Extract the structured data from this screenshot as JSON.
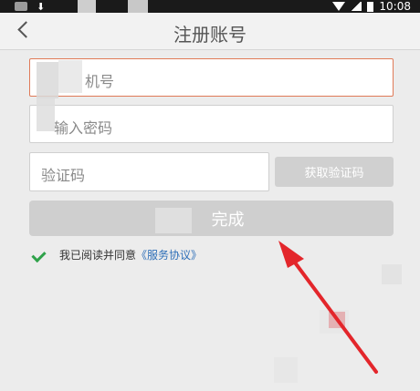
{
  "status_bar": {
    "time": "10:08"
  },
  "header": {
    "title": "注册账号"
  },
  "form": {
    "phone_placeholder": "机号",
    "password_placeholder": "输入密码",
    "code_placeholder": "验证码",
    "get_code_label": "获取验证码",
    "submit_label": "完成"
  },
  "agreement": {
    "text": "我已阅读并同意",
    "link": "《服务协议》",
    "checked": true
  },
  "colors": {
    "accent_border": "#e07a57",
    "link": "#2e6fb8",
    "check": "#2fa24a",
    "arrow": "#e3262b"
  }
}
